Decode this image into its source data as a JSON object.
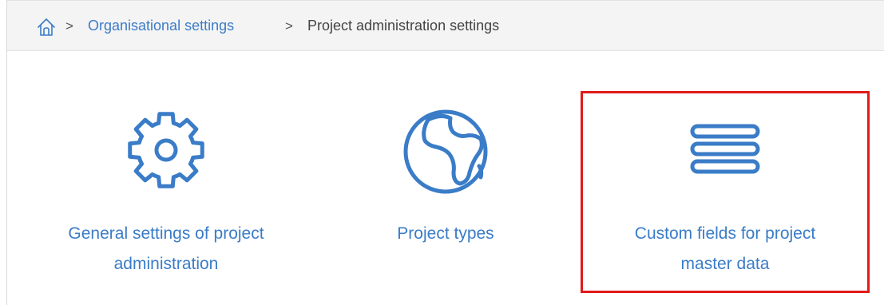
{
  "breadcrumb": {
    "home_icon": "home-icon",
    "separator": ">",
    "items": [
      {
        "label": "Organisational settings",
        "link": true
      },
      {
        "label": "Project administration settings",
        "link": false
      }
    ]
  },
  "tiles": [
    {
      "icon": "gear-icon",
      "label": "General settings of project\nadministration"
    },
    {
      "icon": "globe-icon",
      "label": "Project types"
    },
    {
      "icon": "list-icon",
      "label": "Custom fields for project\nmaster data",
      "highlighted": true
    }
  ],
  "colors": {
    "accent": "#3a7cc7",
    "highlight": "#e01b1b",
    "breadcrumb_bg": "#f4f4f4"
  }
}
